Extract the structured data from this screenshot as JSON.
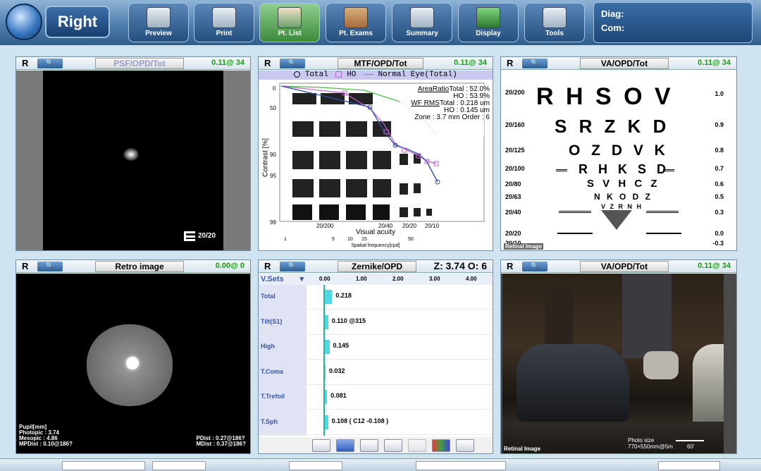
{
  "toolbar": {
    "eye_label": "Right",
    "buttons": [
      {
        "label": "Preview",
        "icon": "preview-icon"
      },
      {
        "label": "Print",
        "icon": "printer-icon"
      },
      {
        "label": "Pt. List",
        "icon": "patient-icon"
      },
      {
        "label": "Pt. Exams",
        "icon": "exams-icon"
      },
      {
        "label": "Summary",
        "icon": "summary-icon"
      },
      {
        "label": "Display",
        "icon": "display-icon"
      },
      {
        "label": "Tools",
        "icon": "tools-icon"
      }
    ],
    "diag_label": "Diag:",
    "com_label": "Com:"
  },
  "panels": {
    "psf": {
      "eye": "R",
      "title": "PSF/OPD/Tot",
      "value": "0.11@ 34",
      "acuity": "20/20"
    },
    "mtf": {
      "eye": "R",
      "title": "MTF/OPD/Tot",
      "value": "0.11@ 34",
      "legend": {
        "total": "Total",
        "ho": "HO",
        "normal": "Normal Eye(Total)"
      },
      "stats": {
        "area_ratio_label": "AreaRatio",
        "area_total": "Total : 52.0%",
        "area_ho": "HO : 53.9%",
        "wf_rms_label": "WF RMS",
        "wf_total": "Total : 0.218 um",
        "wf_ho": "HO : 0.145 um",
        "zone": "Zone : 3.7 mm Order : 6"
      },
      "y_label": "Contrast [%]",
      "x_label": "Visual acuity",
      "x2_label": "Spatial frequency[cpd]",
      "y_ticks": [
        "0",
        "50",
        "90",
        "95",
        "99"
      ],
      "va_ticks": [
        "20/200",
        "20/40",
        "20/20",
        "20/10"
      ],
      "cpd_ticks": [
        "1",
        "5",
        "10",
        "15",
        "50"
      ]
    },
    "va_chart": {
      "eye": "R",
      "title": "VA/OPD/Tot",
      "value": "0.11@ 34",
      "rows": [
        {
          "left": "20/200",
          "letters": "R H S O V",
          "right": "1.0"
        },
        {
          "left": "20/160",
          "letters": "S R Z K D",
          "right": "0.9"
        },
        {
          "left": "20/125",
          "letters": "O Z D V K",
          "right": "0.8"
        },
        {
          "left": "20/100",
          "letters": "R H K S D",
          "right": "0.7"
        },
        {
          "left": "20/80",
          "letters": "S V H C Z",
          "right": "0.6"
        },
        {
          "left": "20/63",
          "letters": "N K O D Z",
          "right": "0.5"
        },
        {
          "left": "20/40",
          "letters": "V Z R N H",
          "right": "0.3"
        },
        {
          "left": "20/20",
          "letters": "",
          "right": "0.0"
        },
        {
          "left": "20/10",
          "letters": "",
          "right": "-0.3"
        }
      ],
      "footer": "Retinal Image"
    },
    "retro": {
      "eye": "R",
      "title": "Retro image",
      "value": "0.00@ 0",
      "pupil_label": "Pupil[mm]",
      "photopic": "Photopic : 3.74",
      "mesopic": "Mesopic : 4.86",
      "mpdist_left": "MPDist : 0.10@186?",
      "pdist": "PDist : 0.27@186?",
      "mdist": "MDist : 0.37@186?"
    },
    "zernike": {
      "eye": "R",
      "title": "Zernike/OPD",
      "value": "Z: 3.74 O: 6",
      "dropdown": "V.Sets",
      "axis": [
        "0.00",
        "1.00",
        "2.00",
        "3.00",
        "4.00"
      ],
      "rows": [
        {
          "name": "Total",
          "value": "0.218",
          "amount": 0.218
        },
        {
          "name": "Tilt(S1)",
          "value": "0.110 @315",
          "amount": 0.11
        },
        {
          "name": "High",
          "value": "0.145",
          "amount": 0.145
        },
        {
          "name": "T.Coma",
          "value": "0.032",
          "amount": 0.032
        },
        {
          "name": "T.Trefoil",
          "value": "0.081",
          "amount": 0.081
        },
        {
          "name": "T.Sph",
          "value": "0.108 ( C12 -0.108 )",
          "amount": 0.108
        }
      ],
      "tools": [
        "bars-icon",
        "refresh-icon",
        "down-icon",
        "copy-icon",
        "disabled-icon",
        "palette-icon",
        "eye-icon"
      ]
    },
    "va_image": {
      "eye": "R",
      "title": "VA/OPD/Tot",
      "value": "0.11@ 34",
      "footer": "Retinal Image",
      "photo_size_label": "Photo size",
      "photo_size": "770×550mm@5m",
      "angle": "60'"
    }
  },
  "colors": {
    "accent_green": "#12a012",
    "bar_cyan": "#4fd8e6",
    "ho_magenta": "#c060d0",
    "total_blue": "#3050a0",
    "normal_green": "#40c040"
  }
}
